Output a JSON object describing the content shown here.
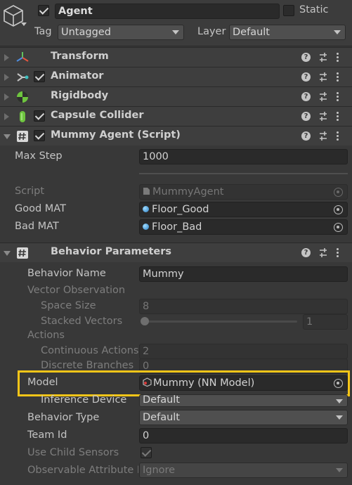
{
  "header": {
    "active": true,
    "name": "Agent",
    "static_label": "Static",
    "static_checked": false,
    "tag_label": "Tag",
    "tag_value": "Untagged",
    "layer_label": "Layer",
    "layer_value": "Default"
  },
  "components": {
    "transform": {
      "title": "Transform"
    },
    "animator": {
      "title": "Animator",
      "enabled": true
    },
    "rigidbody": {
      "title": "Rigidbody"
    },
    "capsule": {
      "title": "Capsule Collider",
      "enabled": true
    },
    "mummy_agent": {
      "title": "Mummy Agent (Script)",
      "enabled": true,
      "max_step_label": "Max Step",
      "max_step_value": "1000",
      "script_label": "Script",
      "script_value": "MummyAgent",
      "good_mat_label": "Good MAT",
      "good_mat_value": "Floor_Good",
      "bad_mat_label": "Bad MAT",
      "bad_mat_value": "Floor_Bad"
    },
    "behavior_parameters": {
      "title": "Behavior Parameters",
      "behavior_name_label": "Behavior Name",
      "behavior_name_value": "Mummy",
      "vector_observation_label": "Vector Observation",
      "space_size_label": "Space Size",
      "space_size_value": "8",
      "stacked_vectors_label": "Stacked Vectors",
      "stacked_vectors_value": "1",
      "stacked_vectors_level": 0,
      "actions_label": "Actions",
      "continuous_actions_label": "Continuous Actions",
      "continuous_actions_value": "2",
      "discrete_branches_label": "Discrete Branches",
      "discrete_branches_value": "0",
      "model_label": "Model",
      "model_value": "Mummy (NN Model)",
      "inference_device_label": "Inference Device",
      "inference_device_value": "Default",
      "behavior_type_label": "Behavior Type",
      "behavior_type_value": "Default",
      "team_id_label": "Team Id",
      "team_id_value": "0",
      "use_child_sensors_label": "Use Child Sensors",
      "use_child_sensors_checked": true,
      "observable_attr_label": "Observable Attribute H",
      "observable_attr_value": "Ignore"
    }
  },
  "colors": {
    "background": "#383838",
    "highlight": "#f5c518",
    "field": "#2a2a2a"
  },
  "icons": {
    "gameobject": "cube-icon",
    "transform": "transform-axes-icon",
    "animator": "animator-icon",
    "rigidbody": "rigidbody-icon",
    "capsule": "capsule-collider-icon",
    "script": "csharp-script-icon",
    "help": "help-icon",
    "settings": "preset-settings-icon",
    "menu": "kebab-menu-icon",
    "object_picker": "object-picker-icon"
  }
}
